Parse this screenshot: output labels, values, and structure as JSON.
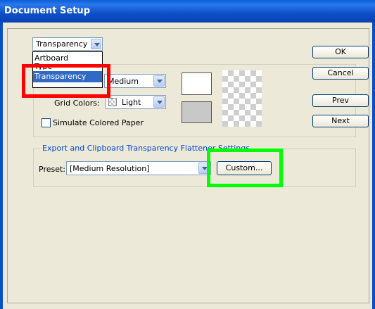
{
  "window": {
    "title": "Document Setup"
  },
  "section_select": {
    "value": "Transparency",
    "options": [
      "Artboard",
      "Type",
      "Transparency"
    ],
    "selected": "Transparency"
  },
  "grid": {
    "size_value": "Medium",
    "colors_label": "Grid Colors:",
    "colors_value": "Light"
  },
  "simulate_paper": {
    "label": "Simulate Colored Paper",
    "checked": false
  },
  "flattener": {
    "group_title": "Export and Clipboard Transparency Flattener Settings",
    "preset_label": "Preset:",
    "preset_value": "[Medium Resolution]",
    "custom_label": "Custom..."
  },
  "buttons": {
    "ok": "OK",
    "cancel": "Cancel",
    "prev": "Prev",
    "next": "Next"
  },
  "colors": {
    "title_bar": "#0a5fd8",
    "highlight_red": "#ff0000",
    "highlight_green": "#00ff00",
    "selection": "#316ac5"
  }
}
